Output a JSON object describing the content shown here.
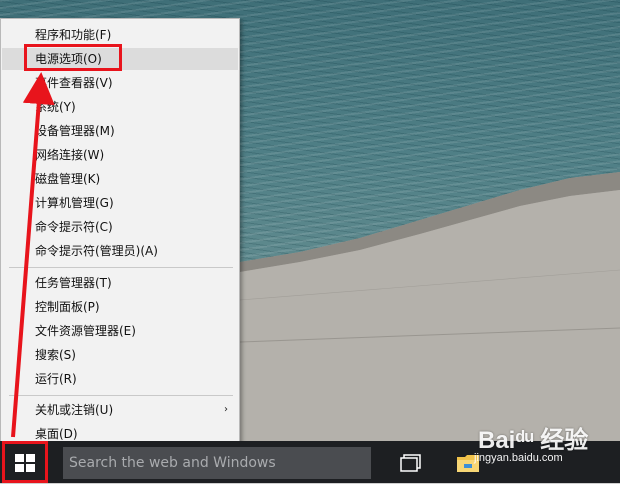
{
  "menu": {
    "items": [
      {
        "label": "程序和功能(F)"
      },
      {
        "label": "电源选项(O)"
      },
      {
        "label": "事件查看器(V)"
      },
      {
        "label": "系统(Y)"
      },
      {
        "label": "设备管理器(M)"
      },
      {
        "label": "网络连接(W)"
      },
      {
        "label": "磁盘管理(K)"
      },
      {
        "label": "计算机管理(G)"
      },
      {
        "label": "命令提示符(C)"
      },
      {
        "label": "命令提示符(管理员)(A)"
      },
      {
        "label": "任务管理器(T)"
      },
      {
        "label": "控制面板(P)"
      },
      {
        "label": "文件资源管理器(E)"
      },
      {
        "label": "搜索(S)"
      },
      {
        "label": "运行(R)"
      },
      {
        "label": "关机或注销(U)"
      },
      {
        "label": "桌面(D)"
      }
    ],
    "submenu_arrow": "›",
    "highlighted_item": "电源选项(O)"
  },
  "taskbar": {
    "search_placeholder": "Search the web and Windows",
    "icons": [
      "windows-logo-icon",
      "task-view-icon",
      "file-explorer-icon"
    ]
  },
  "watermark": {
    "brand": "Baiᵈᵘ 经验",
    "url": "jingyan.baidu.com"
  },
  "colors": {
    "highlight": "#e8141c",
    "taskbar": "#1d1f22",
    "menu_bg": "#f2f2f2",
    "menu_hover": "#dcdcdc"
  }
}
